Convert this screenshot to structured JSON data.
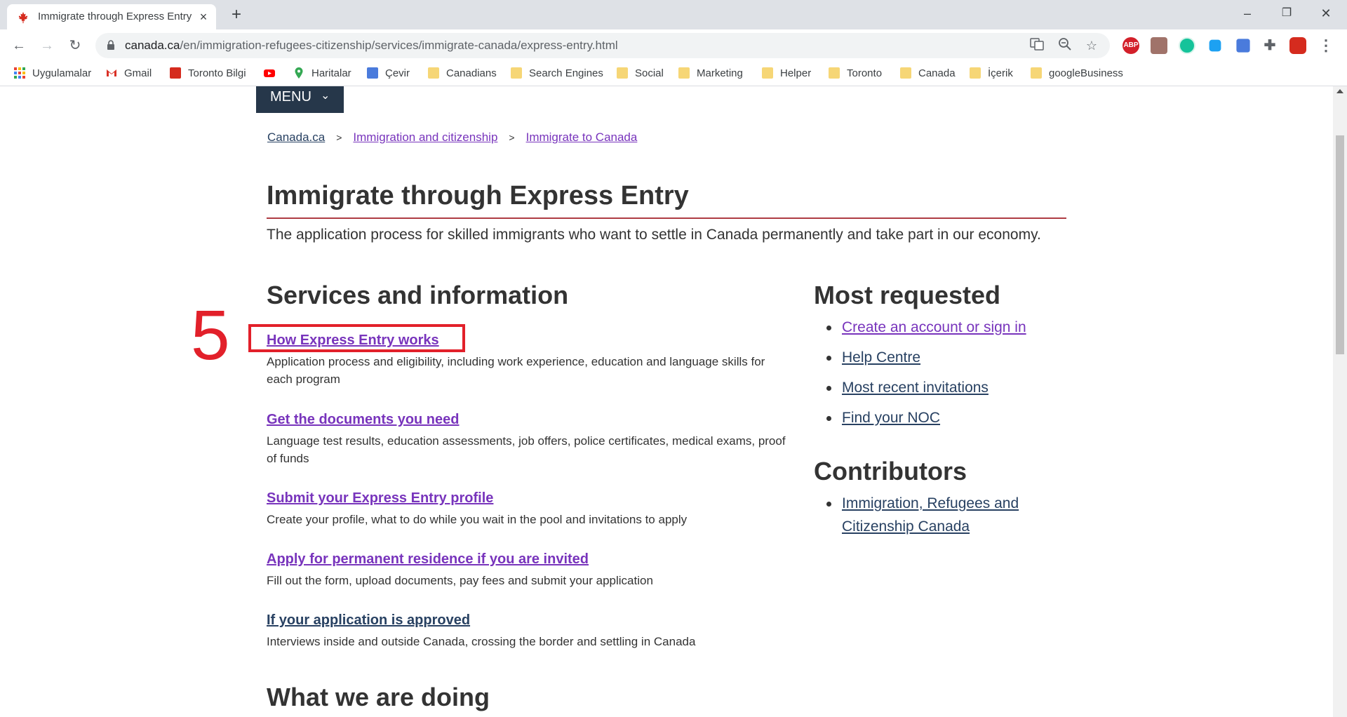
{
  "browser": {
    "tab_title": "Immigrate through Express Entry",
    "new_tab": "+",
    "url_host": "canada.ca",
    "url_path": "/en/immigration-refugees-citizenship/services/immigrate-canada/express-entry.html",
    "extensions": {
      "abp": "ABP"
    },
    "window_controls": {
      "minimize": "–",
      "restore": "❐",
      "close": "✕"
    }
  },
  "bookmarks": [
    {
      "label": "Uygulamalar",
      "icon": "apps-grid-icon"
    },
    {
      "label": "Gmail",
      "icon": "gmail-icon"
    },
    {
      "label": "Toronto Bilgi",
      "icon": "toronto-bilgi-icon"
    },
    {
      "label": "",
      "icon": "youtube-icon"
    },
    {
      "label": "Haritalar",
      "icon": "maps-pin-icon"
    },
    {
      "label": "Çevir",
      "icon": "translate-icon"
    },
    {
      "label": "Canadians",
      "icon": "folder-icon"
    },
    {
      "label": "Search Engines",
      "icon": "folder-icon"
    },
    {
      "label": "Social",
      "icon": "folder-icon"
    },
    {
      "label": "Marketing",
      "icon": "folder-icon"
    },
    {
      "label": "Helper",
      "icon": "folder-icon"
    },
    {
      "label": "Toronto",
      "icon": "folder-icon"
    },
    {
      "label": "Canada",
      "icon": "folder-icon"
    },
    {
      "label": "İçerik",
      "icon": "folder-icon"
    },
    {
      "label": "googleBusiness",
      "icon": "folder-icon"
    }
  ],
  "page": {
    "menu_label": "MENU",
    "breadcrumbs": [
      "Canada.ca",
      "Immigration and citizenship",
      "Immigrate to Canada"
    ],
    "breadcrumb_sep": ">",
    "title": "Immigrate through Express Entry",
    "lead": "The application process for skilled immigrants who want to settle in Canada permanently and take part in our economy.",
    "services_heading": "Services and information",
    "services": [
      {
        "link": "How Express Entry works",
        "desc": "Application process and eligibility, including work experience, education and language skills for each program"
      },
      {
        "link": "Get the documents you need",
        "desc": "Language test results, education assessments, job offers, police certificates, medical exams, proof of funds"
      },
      {
        "link": "Submit your Express Entry profile",
        "desc": "Create your profile, what to do while you wait in the pool and invitations to apply"
      },
      {
        "link": "Apply for permanent residence if you are invited",
        "desc": "Fill out the form, upload documents, pay fees and submit your application"
      },
      {
        "link": "If your application is approved",
        "desc": "Interviews inside and outside Canada, crossing the border and settling in Canada"
      }
    ],
    "next_heading": "What we are doing",
    "most_requested_heading": "Most requested",
    "most_requested": [
      "Create an account or sign in",
      "Help Centre",
      "Most recent invitations",
      "Find your NOC"
    ],
    "contributors_heading": "Contributors",
    "contributors": [
      "Immigration, Refugees and Citizenship Canada"
    ],
    "annotation_number": "5"
  },
  "colors": {
    "link_visited": "#7834bc",
    "link": "#284162",
    "menu_bg": "#26374a",
    "title_rule": "#af3c43",
    "annotation_red": "#e2202a"
  }
}
